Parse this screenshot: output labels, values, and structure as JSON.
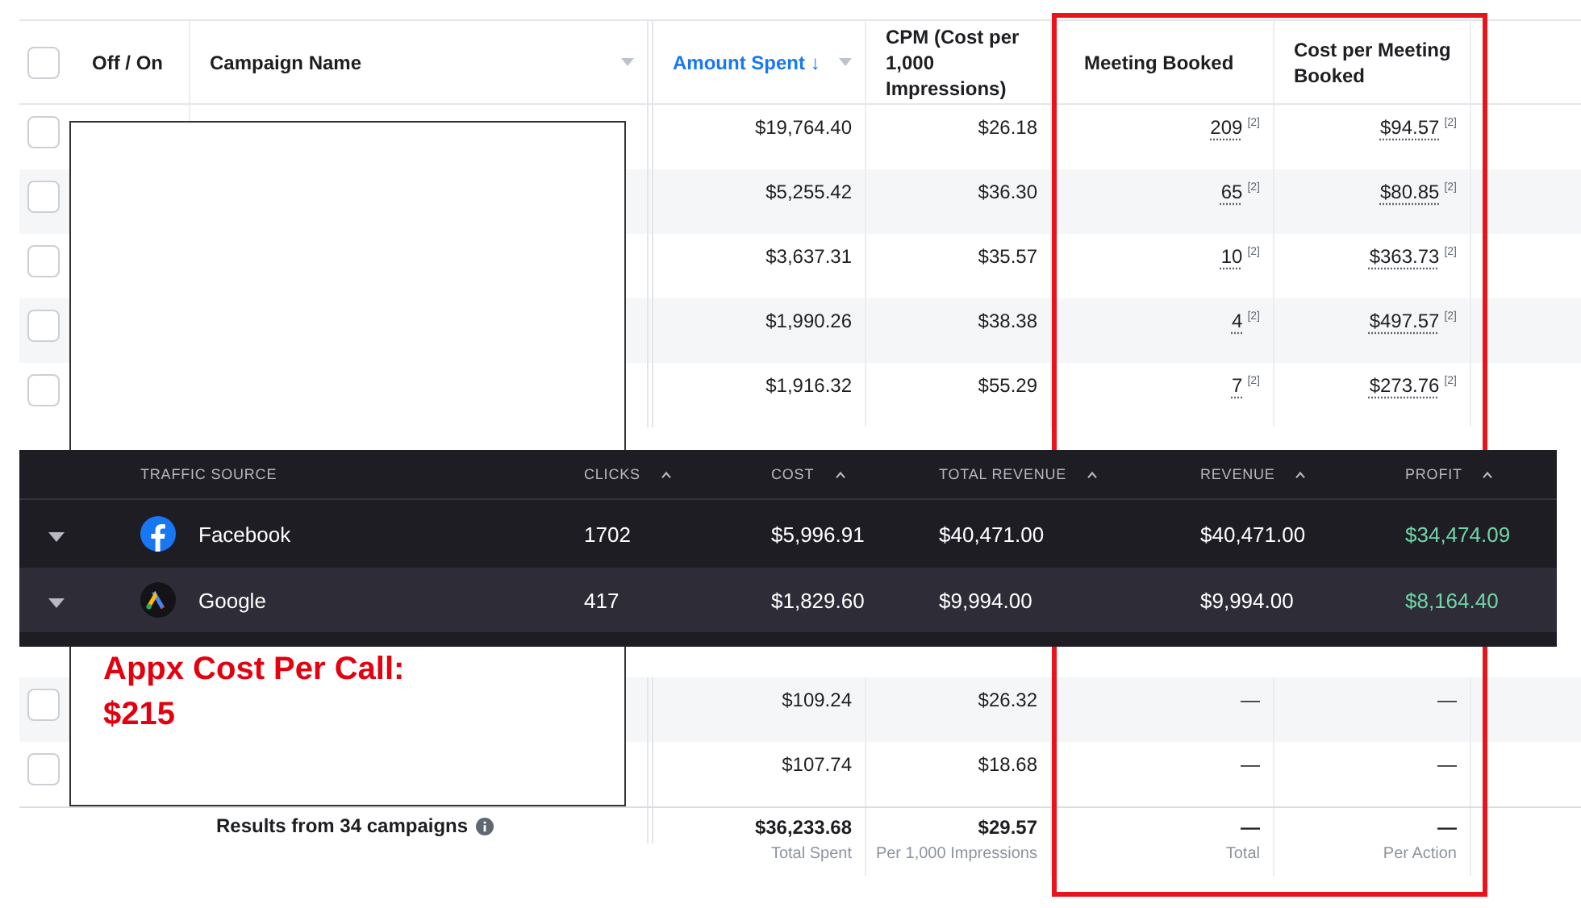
{
  "campaign_table": {
    "header_checkbox": {
      "checked": false
    },
    "columns": [
      {
        "label": "Off / On",
        "sorted": false,
        "menu": false
      },
      {
        "label": "Campaign Name",
        "sorted": false,
        "menu": true
      },
      {
        "label": "Amount Spent ↓",
        "sorted": true,
        "menu": true
      },
      {
        "label": "CPM (Cost per 1,000 Impressions)",
        "sorted": false,
        "menu": false
      },
      {
        "label": "Meeting Booked",
        "sorted": false,
        "menu": false
      },
      {
        "label": "Cost per Meeting Booked",
        "sorted": false,
        "menu": false
      }
    ],
    "rows_above": [
      {
        "checked": false,
        "amount_spent": "$19,764.40",
        "cpm": "$26.18",
        "meetings": "209",
        "meetings_note": "[2]",
        "cost_per_meeting": "$94.57",
        "cost_note": "[2]"
      },
      {
        "checked": false,
        "amount_spent": "$5,255.42",
        "cpm": "$36.30",
        "meetings": "65",
        "meetings_note": "[2]",
        "cost_per_meeting": "$80.85",
        "cost_note": "[2]"
      },
      {
        "checked": false,
        "amount_spent": "$3,637.31",
        "cpm": "$35.57",
        "meetings": "10",
        "meetings_note": "[2]",
        "cost_per_meeting": "$363.73",
        "cost_note": "[2]"
      },
      {
        "checked": false,
        "amount_spent": "$1,990.26",
        "cpm": "$38.38",
        "meetings": "4",
        "meetings_note": "[2]",
        "cost_per_meeting": "$497.57",
        "cost_note": "[2]"
      },
      {
        "checked": false,
        "amount_spent": "$1,916.32",
        "cpm": "$55.29",
        "meetings": "7",
        "meetings_note": "[2]",
        "cost_per_meeting": "$273.76",
        "cost_note": "[2]"
      }
    ],
    "rows_below": [
      {
        "checked": false,
        "amount_spent": "$109.24",
        "cpm": "$26.32",
        "meetings": "—",
        "cost_per_meeting": "—"
      },
      {
        "checked": false,
        "amount_spent": "$107.74",
        "cpm": "$18.68",
        "meetings": "—",
        "cost_per_meeting": "—"
      }
    ],
    "footer": {
      "label": "Results from 34 campaigns",
      "amount_spent": "$36,233.68",
      "amount_caption": "Total Spent",
      "cpm": "$29.57",
      "cpm_caption": "Per 1,000 Impressions",
      "meetings": "—",
      "meetings_caption": "Total",
      "cost_per_meeting": "—",
      "cost_caption": "Per Action"
    }
  },
  "annotation": {
    "text": "Appx Cost Per Call: $215"
  },
  "traffic_sources": {
    "columns": [
      {
        "label": "TRAFFIC SOURCE",
        "sortable": false
      },
      {
        "label": "CLICKS",
        "sortable": true
      },
      {
        "label": "COST",
        "sortable": true
      },
      {
        "label": "TOTAL REVENUE",
        "sortable": true
      },
      {
        "label": "REVENUE",
        "sortable": true
      },
      {
        "label": "PROFIT",
        "sortable": true
      }
    ],
    "rows": [
      {
        "kind": "facebook",
        "source": "Facebook",
        "clicks": "1702",
        "cost": "$5,996.91",
        "total_revenue": "$40,471.00",
        "revenue": "$40,471.00",
        "profit": "$34,474.09"
      },
      {
        "kind": "google",
        "source": "Google",
        "clicks": "417",
        "cost": "$1,829.60",
        "total_revenue": "$9,994.00",
        "revenue": "$9,994.00",
        "profit": "$8,164.40"
      }
    ]
  }
}
